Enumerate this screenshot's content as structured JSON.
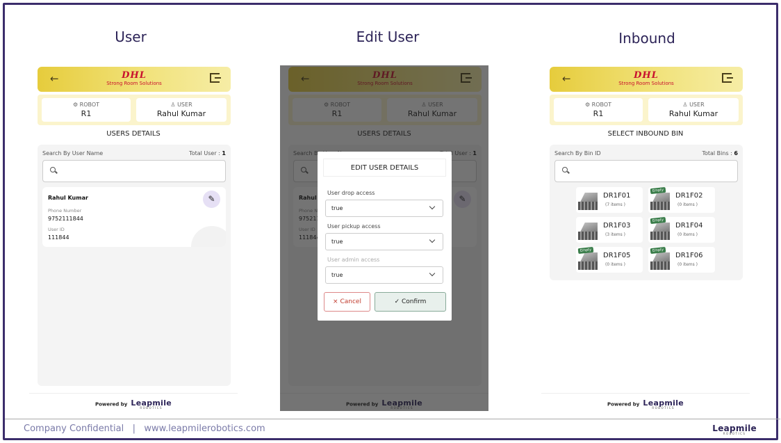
{
  "titles": {
    "user": "User",
    "edit": "Edit User",
    "inbound": "Inbound"
  },
  "header": {
    "logo": "DHL",
    "tagline": "Strong Room Solutions"
  },
  "info": {
    "robot_label": "ROBOT",
    "robot_value": "R1",
    "user_label": "USER",
    "user_value": "Rahul Kumar"
  },
  "user_screen": {
    "section": "USERS DETAILS",
    "search_label": "Search By User Name",
    "total_label": "Total User :",
    "total_value": "1",
    "card": {
      "name": "Rahul Kumar",
      "phone_label": "Phone Number",
      "phone_value": "9752111844",
      "id_label": "User ID",
      "id_value": "111844"
    }
  },
  "edit_modal": {
    "title": "EDIT USER DETAILS",
    "fields": [
      {
        "label": "User drop access",
        "value": "true",
        "enabled": true
      },
      {
        "label": "User pickup access",
        "value": "true",
        "enabled": true
      },
      {
        "label": "User admin access",
        "value": "true",
        "enabled": false
      }
    ],
    "cancel": "× Cancel",
    "confirm": "✓ Confirm"
  },
  "inbound_screen": {
    "section": "SELECT INBOUND BIN",
    "search_label": "Search By Bin ID",
    "total_label": "Total Bins :",
    "total_value": "6",
    "empty_badge": "Empty",
    "bins": [
      {
        "id": "DR1F01",
        "count": "(7 items )",
        "empty": false
      },
      {
        "id": "DR1F02",
        "count": "(0 items )",
        "empty": true
      },
      {
        "id": "DR1F03",
        "count": "(3 items )",
        "empty": false
      },
      {
        "id": "DR1F04",
        "count": "(0 items )",
        "empty": true
      },
      {
        "id": "DR1F05",
        "count": "(0 items )",
        "empty": true
      },
      {
        "id": "DR1F06",
        "count": "(0 items )",
        "empty": true
      }
    ]
  },
  "footer": {
    "powered": "Powered by",
    "brand": "Leapmile",
    "brand_sub": "ROBOTICS"
  },
  "bottom": {
    "confidential": "Company Confidential   |   www.leapmilerobotics.com"
  },
  "colors": {
    "border": "#3b2d6b",
    "header_gold": "#e6cc3c",
    "dhl_red": "#c8102e",
    "empty_green": "#3a7d4a"
  }
}
